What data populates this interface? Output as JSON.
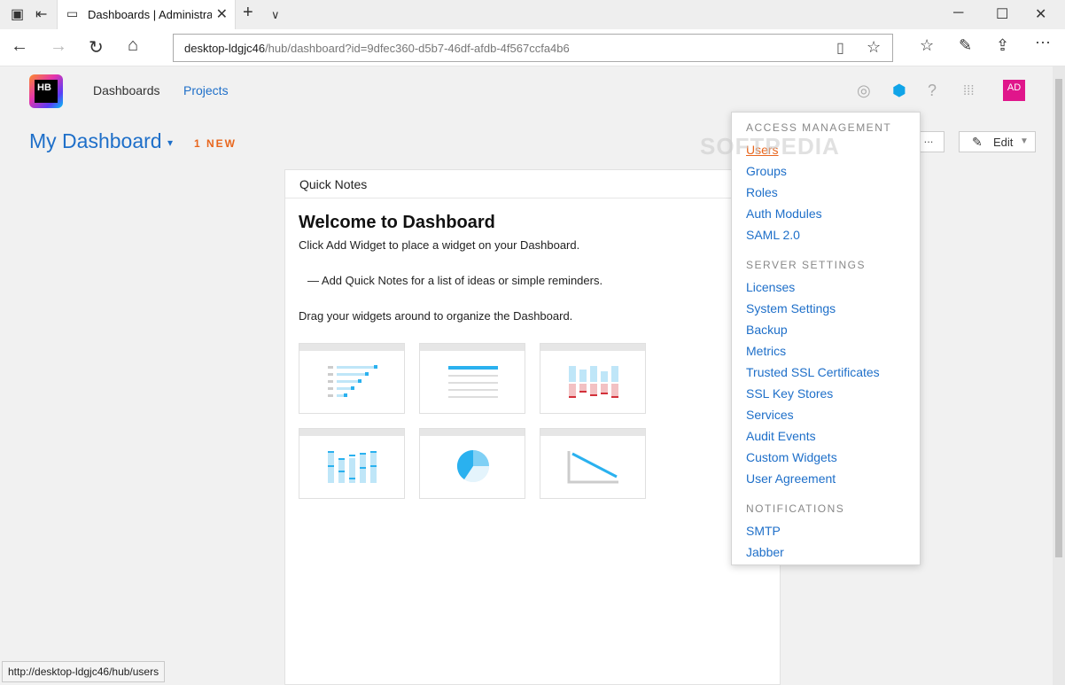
{
  "browser": {
    "tab_title": "Dashboards | Administra",
    "url_host": "desktop-ldgjc46",
    "url_path": "/hub/dashboard?id=9dfec360-d5b7-46df-afdb-4f567ccfa4b6",
    "status_url": "http://desktop-ldgjc46/hub/users"
  },
  "logo_text": "HB",
  "nav": {
    "dashboards": "Dashboards",
    "projects": "Projects"
  },
  "avatar_initials": "AD",
  "dashboard": {
    "title": "My Dashboard",
    "dropdown_glyph": "▾",
    "new_badge": "1 NEW",
    "edit_label": "Edit",
    "hidden_button_label": "..."
  },
  "widget": {
    "header": "Quick Notes",
    "title": "Welcome to Dashboard",
    "line1": "Click Add Widget to place a widget on your Dashboard.",
    "line2": "— Add Quick Notes for a list of ideas or simple reminders.",
    "line3": "Drag your widgets around to organize the Dashboard."
  },
  "menu": {
    "access_header": "ACCESS MANAGEMENT",
    "access_items": [
      "Users",
      "Groups",
      "Roles",
      "Auth Modules",
      "SAML 2.0"
    ],
    "server_header": "SERVER SETTINGS",
    "server_items": [
      "Licenses",
      "System Settings",
      "Backup",
      "Metrics",
      "Trusted SSL Certificates",
      "SSL Key Stores",
      "Services",
      "Audit Events",
      "Custom Widgets",
      "User Agreement"
    ],
    "notif_header": "NOTIFICATIONS",
    "notif_items": [
      "SMTP",
      "Jabber"
    ]
  },
  "watermark": "SOFTPEDIA",
  "colors": {
    "link": "#1e6fc9",
    "accent": "#e8661d",
    "avatar": "#e0168b"
  }
}
